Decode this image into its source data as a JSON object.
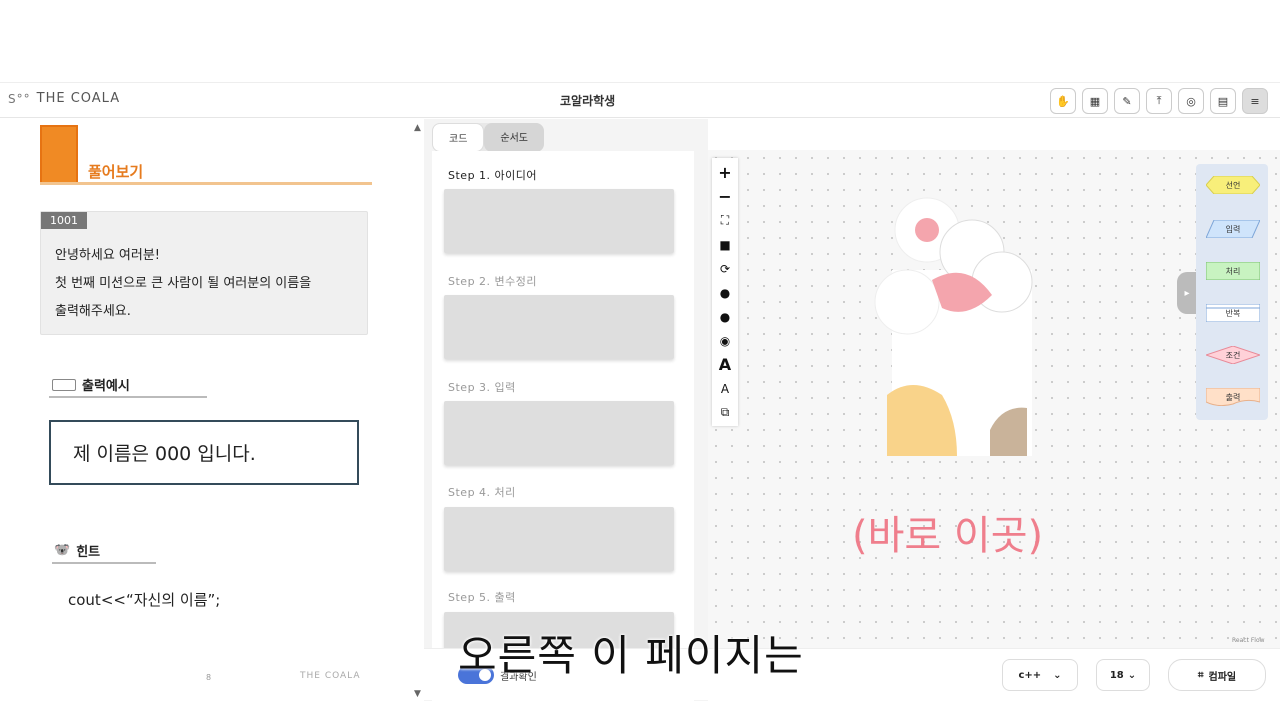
{
  "header": {
    "logo_text": "THE COALA",
    "title": "코알라학생",
    "buttons": [
      "hand-icon",
      "grid-icon",
      "pen-icon",
      "upload-icon",
      "target-icon",
      "layout-icon",
      "menu-icon"
    ]
  },
  "left": {
    "solution_label": "풀어보기",
    "problem_number": "1001",
    "problem_lines": [
      "안녕하세요 여러분!",
      "첫 번째 미션으로 큰 사람이 될 여러분의 이름을",
      "출력해주세요."
    ],
    "example_heading": "출력예시",
    "example_text": "제 이름은 000 입니다.",
    "hint_heading": "힌트",
    "hint_code": "cout<<“자신의 이름”;",
    "page_number": "8",
    "footer_logo": "THE COALA"
  },
  "middle": {
    "tabs": [
      "코드",
      "순서도"
    ],
    "steps": [
      "Step 1. 아이디어",
      "Step 2. 변수정리",
      "Step 3. 입력",
      "Step 4. 처리",
      "Step 5. 출력"
    ]
  },
  "canvas": {
    "tools": [
      "+",
      "−",
      "⛶",
      "🔒",
      "⟳",
      "●",
      "●",
      "📷",
      "A",
      "A",
      "⧉"
    ],
    "palette": [
      "선언",
      "입력",
      "처리",
      "반복",
      "조건",
      "출력"
    ],
    "palette_colors": [
      "#f8ef7a",
      "#cfe4fb",
      "#c8f3c1",
      "#ffffff",
      "#ffd1d8",
      "#ffe0c8"
    ],
    "overlay_text": "(바로 이곳)",
    "attribution": "React Flow"
  },
  "bottom": {
    "toggle_label": "결과확인",
    "language": "c++",
    "font_size": "18",
    "compile_label": "컴파일"
  },
  "subtitle": "오른쪽 이 페이지는"
}
